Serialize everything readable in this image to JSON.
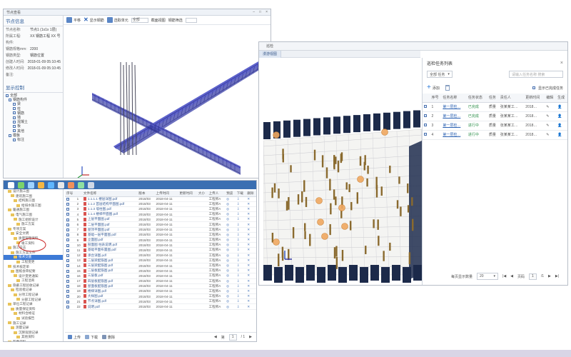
{
  "window1": {
    "title": "节点查看",
    "node_info": {
      "header": "节点信息",
      "rows": [
        {
          "k": "节点名称:",
          "v": "节点1 (1x1x 1层)"
        },
        {
          "k": "所属工程:",
          "v": "XX 钢筋工程 XX 号"
        },
        {
          "k": "构件:",
          "v": ""
        },
        {
          "k": "钢筋规格mm:",
          "v": "2200"
        },
        {
          "k": "钢筋类型:",
          "v": "钢筋位置"
        },
        {
          "k": "创建人时间:",
          "v": "2018-01-09 05:10:45"
        },
        {
          "k": "修改人时间:",
          "v": "2018-01-09 05:10:45"
        },
        {
          "k": "备注:",
          "v": ""
        }
      ]
    },
    "display_control": {
      "header": "显示控制",
      "items": [
        "全部",
        "钢筋构件",
        "梁",
        "柱",
        "钢筋",
        "墙",
        "混凝土",
        "板",
        "其他",
        "模板",
        "标注"
      ]
    },
    "toolbar": {
      "items": [
        "平移",
        "显示钢筋",
        "选取单元",
        "",
        "截面视图",
        "钢筋筛选"
      ],
      "input_value": "全部"
    }
  },
  "window2": {
    "tree": [
      "设计施工图",
      "建筑施工图",
      "结构施工图",
      "给排水施工图",
      "暖通施工图",
      "电气施工图",
      "施工组织设计",
      "施工方案",
      "专项方案",
      "安全文明",
      "质量管理资料",
      "竣工资料",
      "施工日志",
      "施工方案文件",
      "技术交底",
      "工程变更",
      "技术核定单",
      "图纸会审纪要",
      "设计变更通知",
      "工程洽商",
      "隐蔽工程验收记录",
      "检验批记录",
      "分项工程记录",
      "分部工程记录",
      "单位工程记录",
      "质量保证资料",
      "材料合格证",
      "试验报告",
      "施工记录",
      "测量记录",
      "沉降观测记录",
      "其他资料",
      "影像资料"
    ],
    "selected_index": 14,
    "columns": [
      "序号",
      "",
      "文件名称",
      "版本",
      "上传时间",
      "更新时间",
      "大小",
      "上传人",
      "预览",
      "下载",
      "删除"
    ],
    "rows": [
      [
        "1",
        "1.1.1.1 楼层详图.pdf",
        "2018/03",
        "2018-04-11",
        "工程师A"
      ],
      [
        "2",
        "1.1.2 首层结构平面图.pdf",
        "2018/03",
        "2018-04-11",
        "工程师A"
      ],
      [
        "3",
        "1.1.3 墙柱图.pdf",
        "2018/03",
        "2018-04-11",
        "工程师A"
      ],
      [
        "4",
        "1.1.4 楼梯平面图.pdf",
        "2018/03",
        "2018-04-11",
        "工程师A"
      ],
      [
        "5",
        "上层平面图.pdf",
        "2018/03",
        "2018-04-11",
        "工程师A"
      ],
      [
        "6",
        "二层平面图.pdf",
        "2018/03",
        "2018-04-11",
        "工程师A"
      ],
      [
        "7",
        "屋顶平面图.pdf",
        "2018/03",
        "2018-04-11",
        "工程师A"
      ],
      [
        "8",
        "基础一层平面图.pdf",
        "2018/03",
        "2018-04-11",
        "工程师A"
      ],
      [
        "9",
        "立面图.pdf",
        "2018/03",
        "2018-04-11",
        "工程师A"
      ],
      [
        "10",
        "剖面图 柱表说明.pdf",
        "2018/03",
        "2018-04-11",
        "工程师A"
      ],
      [
        "11",
        "基础平面布置图.pdf",
        "2018/03",
        "2018-04-11",
        "工程师A"
      ],
      [
        "12",
        "承台详图.pdf",
        "2018/03",
        "2018-04-11",
        "工程师A"
      ],
      [
        "13",
        "二层梁配筋图.pdf",
        "2018/03",
        "2018-04-11",
        "工程师A"
      ],
      [
        "14",
        "三层梁配筋图.pdf",
        "2018/03",
        "2018-04-11",
        "工程师A"
      ],
      [
        "15",
        "二层板配筋图.pdf",
        "2018/03",
        "2018-04-11",
        "工程师A"
      ],
      [
        "16",
        "三层板.pdf",
        "2018/03",
        "2018-04-11",
        "工程师A"
      ],
      [
        "17",
        "四层板配筋图.pdf",
        "2018/03",
        "2018-04-11",
        "工程师A"
      ],
      [
        "18",
        "屋面板配筋图.pdf",
        "2018/03",
        "2018-04-11",
        "工程师A"
      ],
      [
        "19",
        "楼梯详图.pdf",
        "2018/03",
        "2018-04-11",
        "工程师A"
      ],
      [
        "20",
        "大样图.pdf",
        "2018/03",
        "2018-04-11",
        "工程师A"
      ],
      [
        "21",
        "节点详图.pdf",
        "2018/03",
        "2018-04-11",
        "工程师A"
      ],
      [
        "22",
        "说明.pdf",
        "2018/03",
        "2018-04-11",
        "工程师A"
      ]
    ],
    "footer": {
      "upload": "上传",
      "download": "下载",
      "delete": "删除",
      "page_label": "第",
      "page": "1",
      "total": "/ 1"
    }
  },
  "window3": {
    "title": "巡检",
    "tab": "漫游视图",
    "panel": {
      "title": "巡检任务列表",
      "filter_value": "全部 任务",
      "search_placeholder": "请输入任务名称 搜索",
      "add_label": "添加",
      "show_done_label": "显示已完成任务",
      "columns": [
        "序号",
        "任务名称",
        "任务状态",
        "任务",
        "责任人",
        "更新时间",
        "编辑",
        "生成"
      ],
      "rows": [
        {
          "no": "1",
          "name": "第一层检…",
          "status": "已完成",
          "type": "质量",
          "owner": "张某某工…",
          "date": "2018…"
        },
        {
          "no": "2",
          "name": "第一层检…",
          "status": "已完成",
          "type": "质量",
          "owner": "张某某工…",
          "date": "2018…"
        },
        {
          "no": "3",
          "name": "第一层检…",
          "status": "进行中",
          "type": "质量",
          "owner": "张某某工…",
          "date": "2018…"
        },
        {
          "no": "4",
          "name": "第一层检…",
          "status": "进行中",
          "type": "质量",
          "owner": "张某某工…",
          "date": "2018…"
        }
      ],
      "pager": {
        "size_label": "每页显示数量",
        "size": "20",
        "page_label": "页码",
        "page": "1",
        "total": "/1"
      }
    }
  },
  "colors": {
    "accent": "#3a6fb2",
    "beam": "#2a2f8f",
    "selected": "#3d7ad6",
    "highlight_circle": "#cc2a2a"
  }
}
